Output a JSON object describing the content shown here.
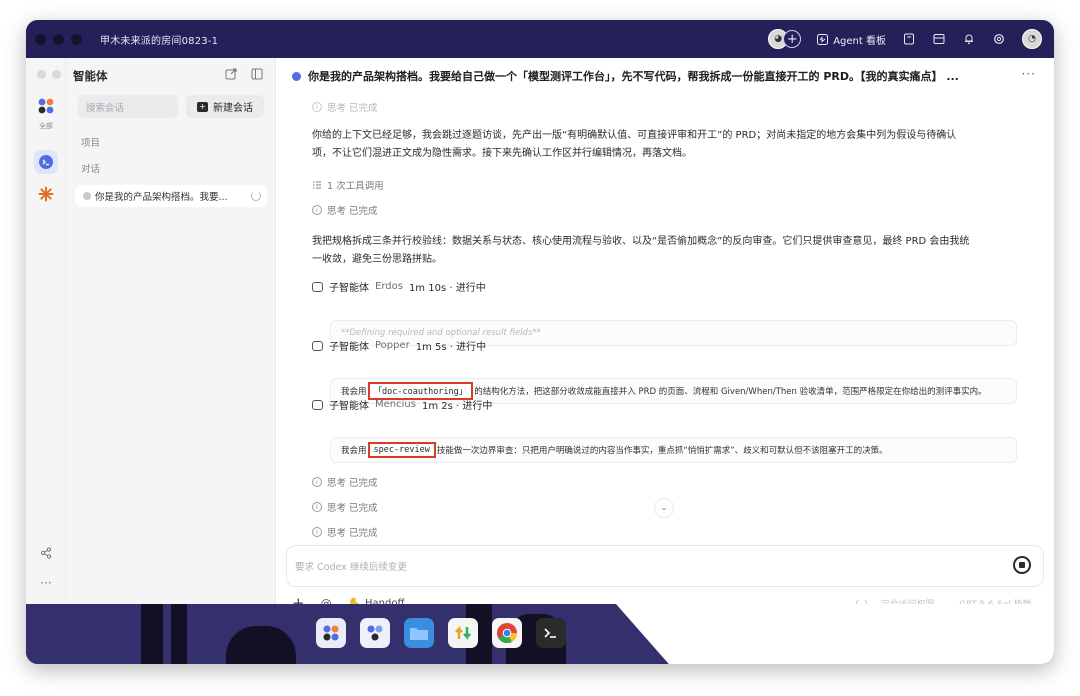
{
  "window": {
    "room_title": "甲木未来派的房间0823-1",
    "agent_board_label": "Agent 看板"
  },
  "sidebar": {
    "title": "智能体",
    "rail_all_label": "全部",
    "search_placeholder": "搜索会话",
    "new_chat_label": "新建会话",
    "section_projects": "项目",
    "section_conversations": "对话",
    "conversation_item": "你是我的产品架构搭档。我要..."
  },
  "main": {
    "title": "你是我的产品架构搭档。我要给自己做一个「模型测评工作台」，先不写代码，帮我拆成一份能直接开工的 PRD。【我的真实痛点】 ...",
    "top_status_partial": "思考 已完成",
    "para1": "你给的上下文已经足够，我会跳过逐题访谈，先产出一版“有明确默认值、可直接评审和开工”的 PRD；对尚未指定的地方会集中列为假设与待确认项，不让它们混进正文成为隐性需求。接下来先确认工作区并行编辑情况，再落文档。",
    "tool_calls": "1 次工具调用",
    "thinking_done": "思考 已完成",
    "para2": "我把规格拆成三条并行校验线：数据关系与状态、核心使用流程与验收、以及“是否偷加概念”的反向审查。它们只提供审查意见，最终 PRD 会由我统一收敛，避免三份思路拼贴。",
    "subagents": [
      {
        "label": "子智能体",
        "name": "Erdos",
        "status": "1m 10s · 进行中",
        "box_text": "**Defining required and optional result fields**"
      },
      {
        "label": "子智能体",
        "name": "Popper",
        "status": "1m 5s · 进行中",
        "box_prefix": "我会用",
        "box_highlight": "「doc-coauthoring」",
        "box_suffix": "的结构化方法，把这部分收敛成能直接并入 PRD 的页面、流程和 Given/When/Then 验收清单，范围严格限定在你给出的测评事实内。"
      },
      {
        "label": "子智能体",
        "name": "Mencius",
        "status": "1m 2s · 进行中",
        "box_prefix": "我会用",
        "box_highlight": "spec-review",
        "box_suffix": "技能做一次边界审查：只把用户明确说过的内容当作事实，重点抓“悄悄扩需求”、歧义和可默认但不该阻塞开工的决策。"
      }
    ],
    "thinking_rows": [
      "思考 已完成",
      "思考 已完成",
      "思考 已完成"
    ]
  },
  "composer": {
    "placeholder": "要求 Codex 继续后续变更",
    "handoff_label": "Handoff",
    "access_label": "完全访问权限",
    "model_label": "GPT-5.6-Sol",
    "effort_label": "极致"
  },
  "colors": {
    "titlebar": "#24215a",
    "highlight_border": "#d83a2a",
    "accent": "#4f6fe0"
  }
}
